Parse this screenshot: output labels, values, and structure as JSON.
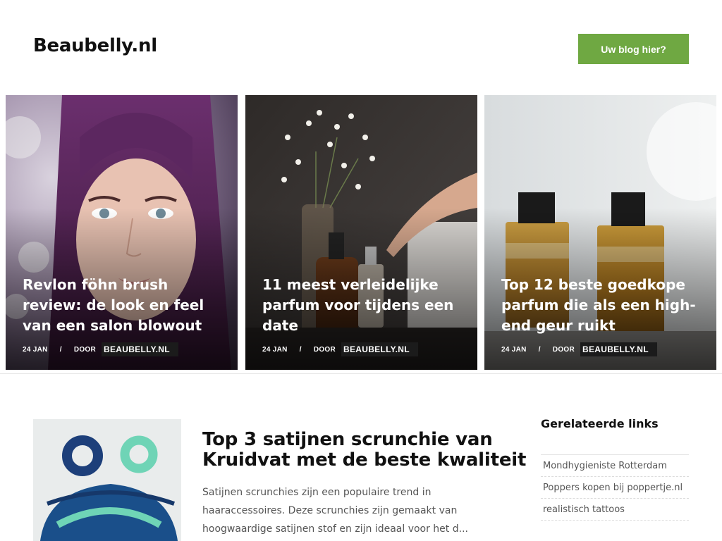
{
  "header": {
    "logo": "Beaubelly.nl",
    "cta_label": "Uw blog hier?"
  },
  "colors": {
    "accent": "#6fa842",
    "text": "#111111",
    "muted": "#555555"
  },
  "featured": [
    {
      "title": "Revlon föhn brush review: de look en feel van een salon blowout",
      "date": "24 JAN",
      "separator": "/",
      "by": "DOOR",
      "author": "BEAUBELLY.NL",
      "image": "woman-purple-hair-portrait"
    },
    {
      "title": "11 meest verleidelijke parfum voor tijdens een date",
      "date": "24 JAN",
      "separator": "/",
      "by": "DOOR",
      "author": "BEAUBELLY.NL",
      "image": "perfume-bottles-with-flowers"
    },
    {
      "title": "Top 12 beste goedkope parfum die als een high-end geur ruikt",
      "date": "24 JAN",
      "separator": "/",
      "by": "DOOR",
      "author": "BEAUBELLY.NL",
      "image": "two-amber-perfume-bottles"
    }
  ],
  "post": {
    "title": "Top 3 satijnen scrunchie van Kruidvat met de beste kwaliteit",
    "excerpt": "Satijnen scrunchies zijn een populaire trend in haaraccessoires. Deze scrunchies zijn gemaakt van hoogwaardige satijnen stof en zijn ideaal voor het d...",
    "image": "satin-scrunchies-photo"
  },
  "sidebar": {
    "heading": "Gerelateerde links",
    "links": [
      "Mondhygieniste Rotterdam",
      "Poppers kopen bij poppertje.nl",
      "realistisch tattoos"
    ]
  }
}
